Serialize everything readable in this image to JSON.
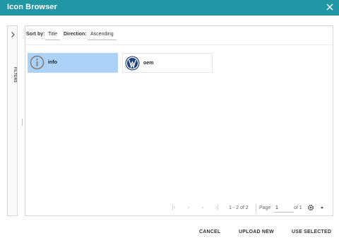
{
  "dialog": {
    "title": "Icon Browser",
    "close_icon": "close-icon"
  },
  "filters": {
    "label": "FILTERS",
    "expand_icon": "chevron-right-icon"
  },
  "sort": {
    "sort_by_label": "Sort by:",
    "sort_by_value": "Title",
    "direction_label": "Direction:",
    "direction_value": "Ascending"
  },
  "icons": [
    {
      "name": "info",
      "icon": "info-icon",
      "selected": true
    },
    {
      "name": "oem",
      "icon": "volkswagen-logo-icon",
      "selected": false
    }
  ],
  "pager": {
    "count": "1 - 2 of 2",
    "page_label": "Page",
    "page_value": "1",
    "of_label": "of 1"
  },
  "footer": {
    "cancel": "CANCEL",
    "upload_new": "UPLOAD NEW",
    "use_selected": "USE SELECTED"
  },
  "colors": {
    "header": "#2196a5",
    "selected_tile": "#acd3f7"
  }
}
